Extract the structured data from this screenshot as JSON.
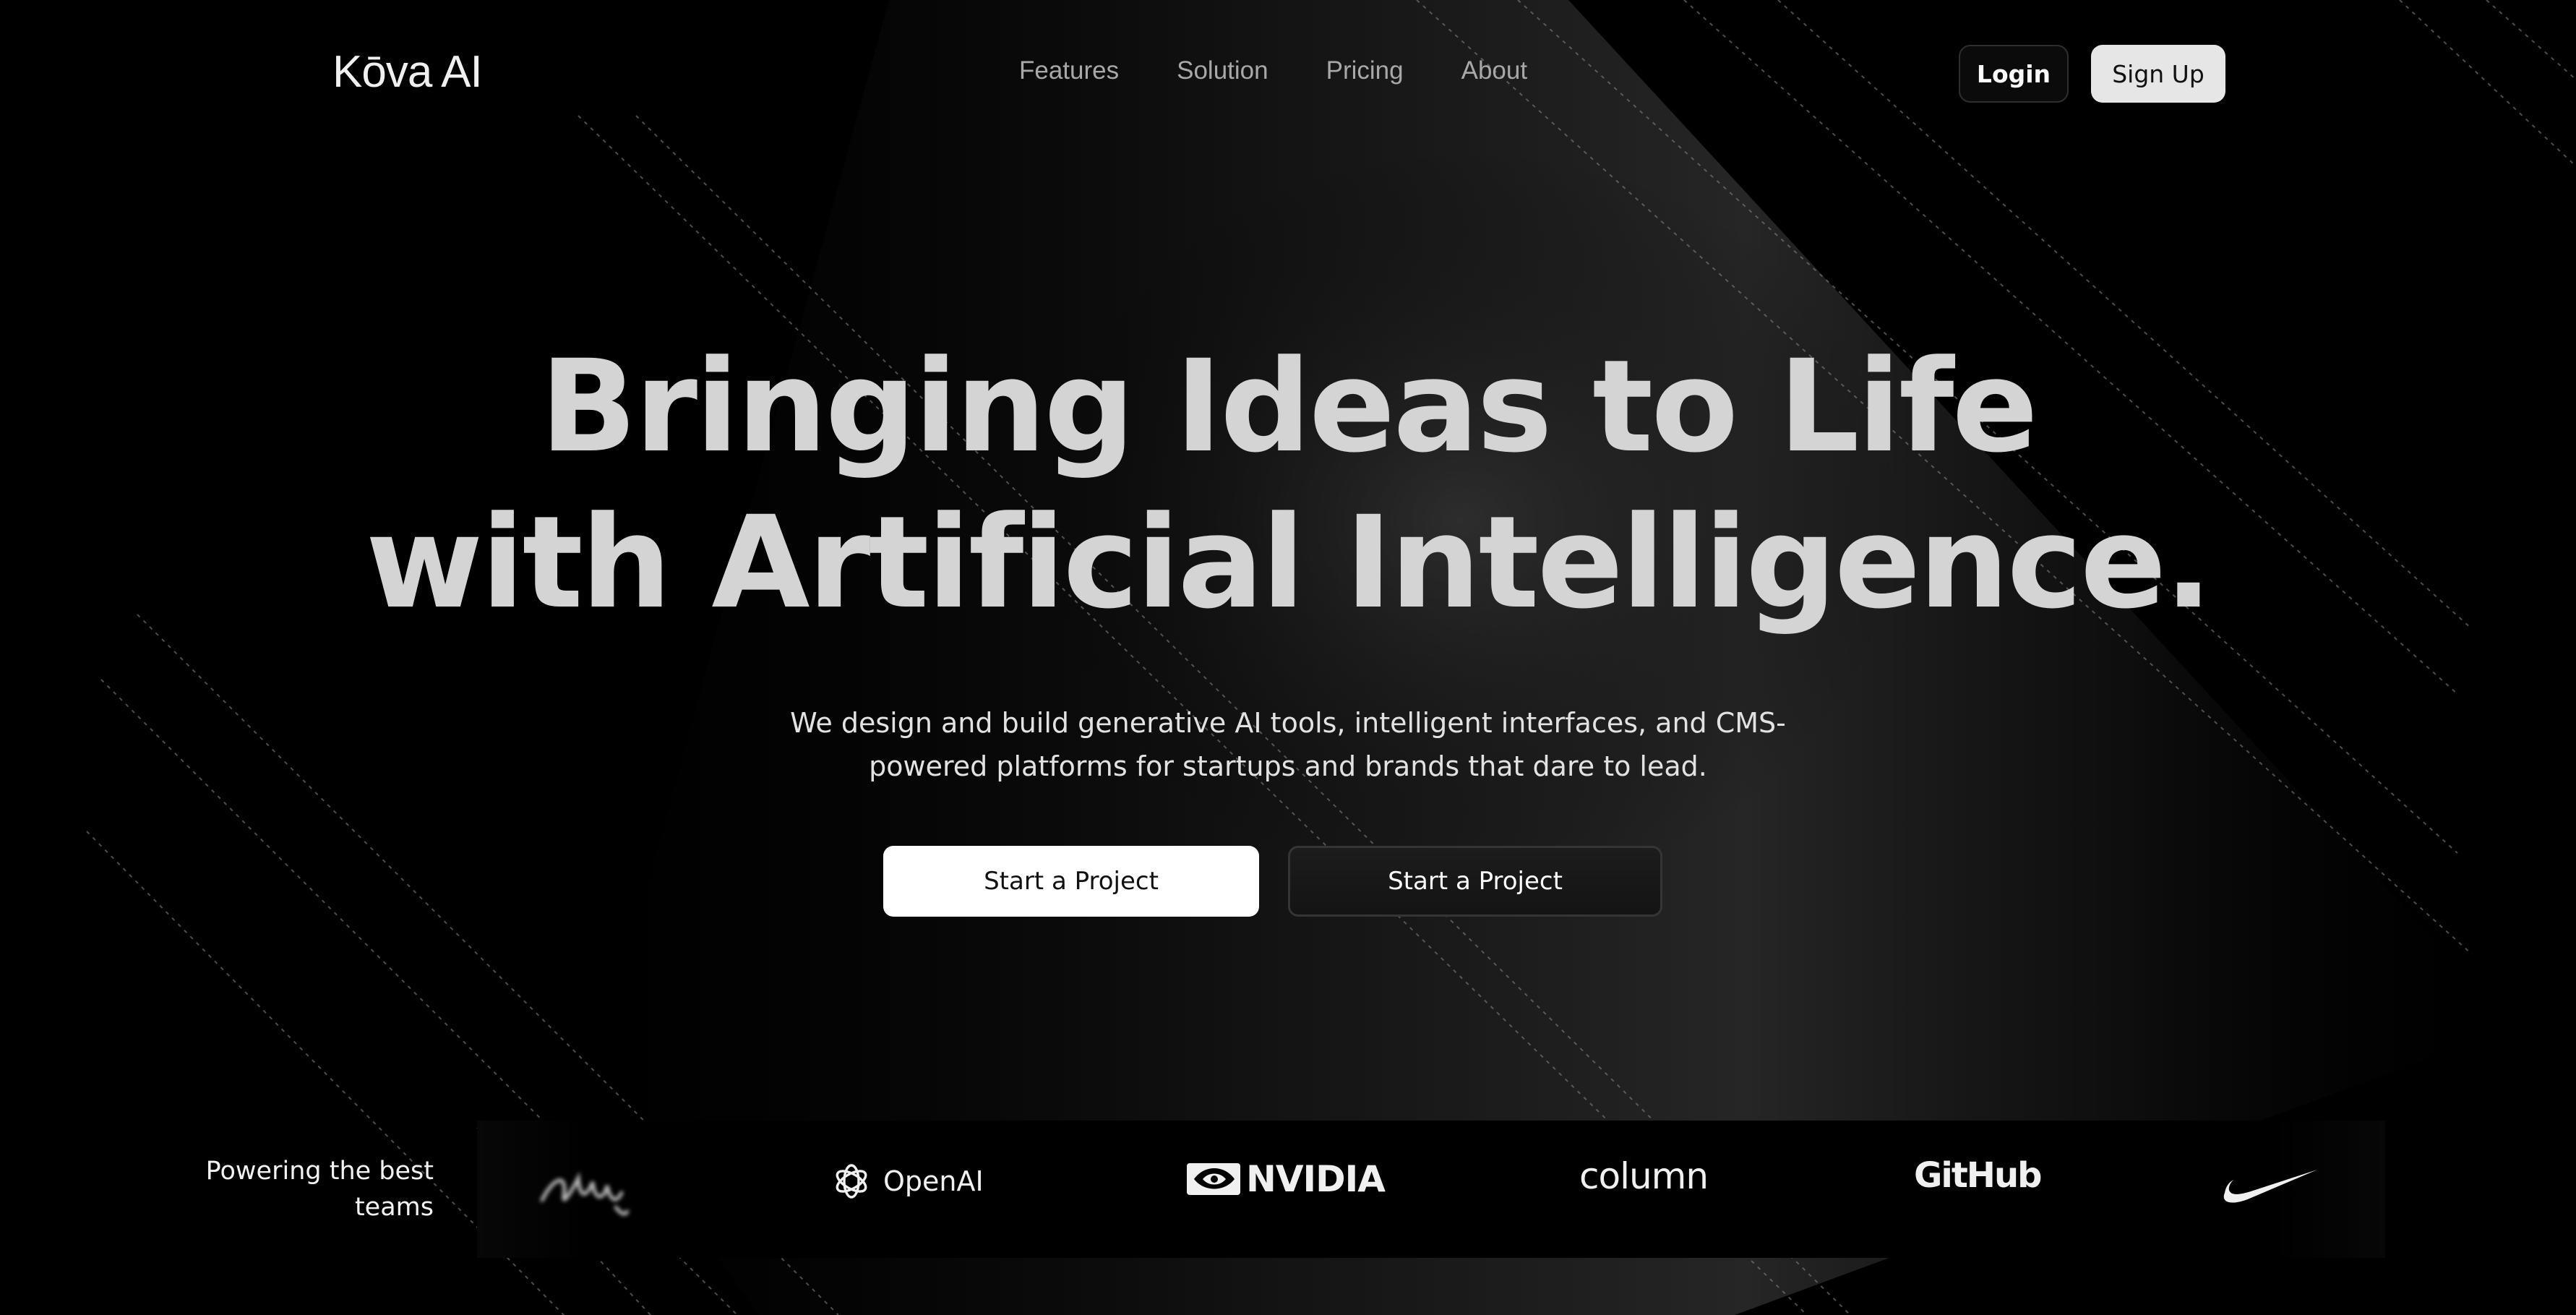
{
  "brand": {
    "name": "Kōva AI"
  },
  "nav": {
    "links": [
      "Features",
      "Solution",
      "Pricing",
      "About"
    ],
    "login_label": "Login",
    "signup_label": "Sign Up"
  },
  "hero": {
    "title_line1": "Bringing Ideas to Life",
    "title_line2": "with Artificial Intelligence.",
    "subtitle": "We design and build generative AI tools, intelligent interfaces, and CMS-powered platforms for startups and brands that dare to lead.",
    "cta_primary": "Start a Project",
    "cta_secondary": "Start a Project"
  },
  "partners": {
    "label": "Powering the best teams",
    "logos": [
      {
        "name": "OpenAI",
        "icon": "openai-icon"
      },
      {
        "name": "NVIDIA",
        "icon": "nvidia-icon"
      },
      {
        "name": "column",
        "icon": ""
      },
      {
        "name": "GitHub",
        "icon": ""
      },
      {
        "name": "",
        "icon": "nike-swoosh-icon"
      },
      {
        "name": "",
        "icon": "script-logo-icon"
      }
    ]
  },
  "colors": {
    "background": "#000000",
    "text": "#e8e8e8",
    "nav_link": "#a8a8a8",
    "primary_button": "#ffffff",
    "signup_button": "#e6e6e6"
  }
}
